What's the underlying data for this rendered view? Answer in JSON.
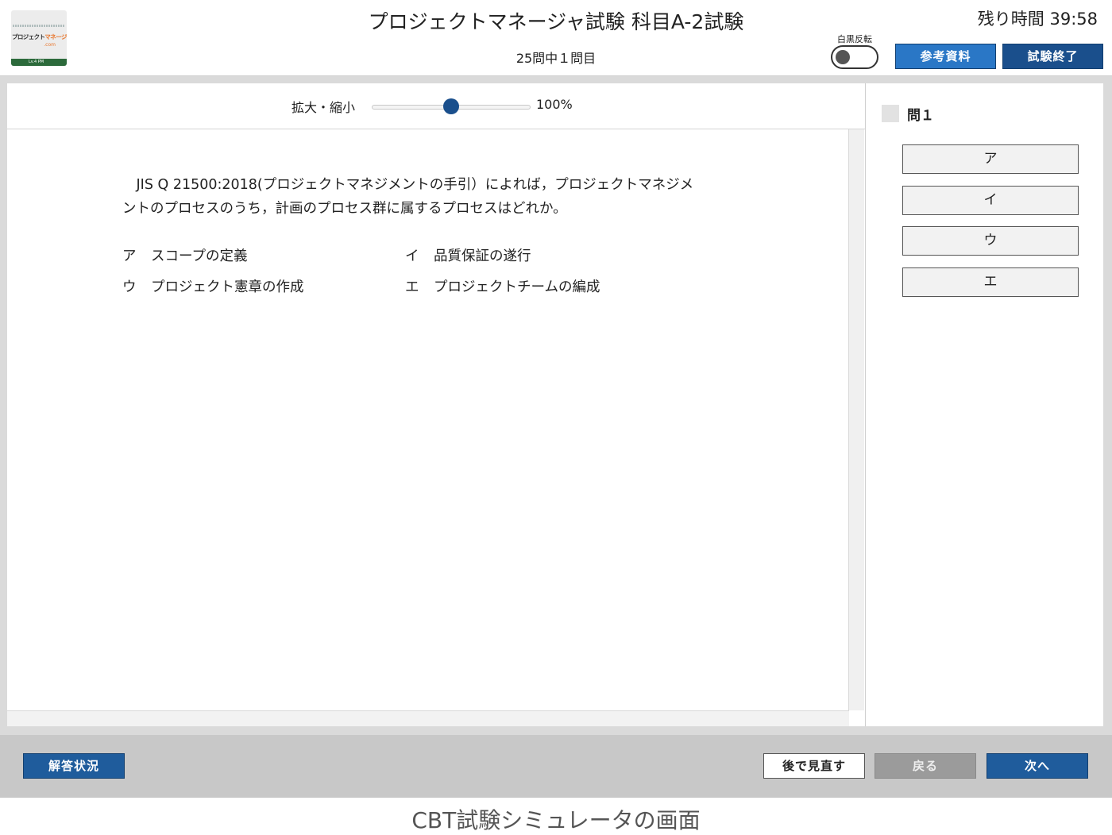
{
  "header": {
    "title": "プロジェクトマネージャ試験 科目A-2試験",
    "progress": "25問中１問目",
    "timer": "残り時間  39:58",
    "invert_label": "白黒反転",
    "reference_button": "参考資料",
    "end_button": "試験終了"
  },
  "logo": {
    "brand_prefix": "プロジェクト",
    "brand_accent": "マネージャ",
    "domain": ".com",
    "level": "Lv.4  PM"
  },
  "zoom": {
    "label": "拡大・縮小",
    "value": "100%",
    "level": 0.5
  },
  "question": {
    "text": "　JIS Q 21500:2018(プロジェクトマネジメントの手引）によれば，プロジェクトマネジメントのプロセスのうち，計画のプロセス群に属するプロセスはどれか。",
    "options": [
      {
        "key": "ア",
        "text": "スコープの定義"
      },
      {
        "key": "イ",
        "text": "品質保証の遂行"
      },
      {
        "key": "ウ",
        "text": "プロジェクト憲章の作成"
      },
      {
        "key": "エ",
        "text": "プロジェクトチームの編成"
      }
    ]
  },
  "answer_panel": {
    "title": "問１",
    "choices": [
      "ア",
      "イ",
      "ウ",
      "エ"
    ]
  },
  "footer": {
    "status_button": "解答状況",
    "later_button": "後で見直す",
    "back_button": "戻る",
    "next_button": "次へ"
  },
  "caption": "CBT試験シミュレータの画面",
  "colors": {
    "primary_blue": "#1f5c9c",
    "dark_blue": "#1a4f8c",
    "disabled_gray": "#9b9b9b"
  }
}
